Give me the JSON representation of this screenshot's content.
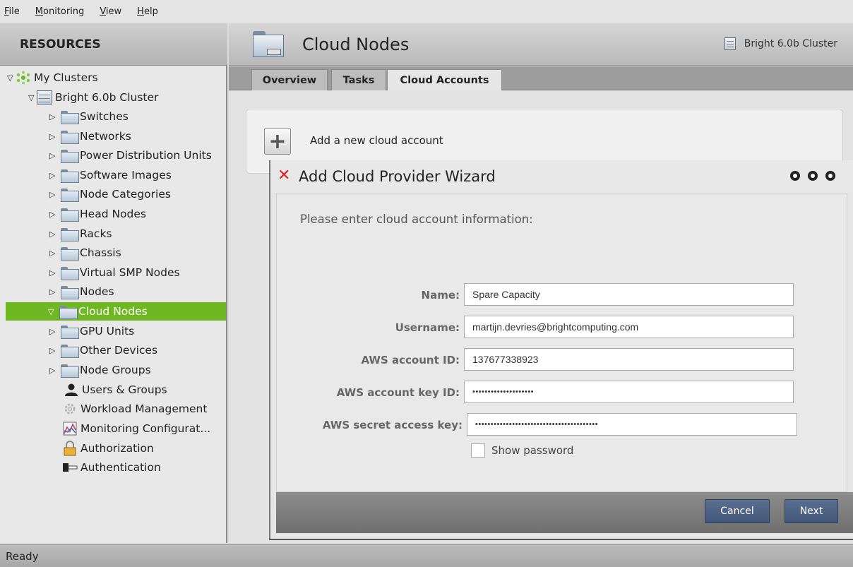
{
  "menubar": {
    "items": [
      "File",
      "Monitoring",
      "View",
      "Help"
    ]
  },
  "sidebar": {
    "title": "RESOURCES",
    "root": "My Clusters",
    "cluster": "Bright 6.0b Cluster",
    "items": [
      {
        "label": "Switches"
      },
      {
        "label": "Networks"
      },
      {
        "label": "Power Distribution Units"
      },
      {
        "label": "Software Images"
      },
      {
        "label": "Node Categories"
      },
      {
        "label": "Head Nodes"
      },
      {
        "label": "Racks"
      },
      {
        "label": "Chassis"
      },
      {
        "label": "Virtual SMP Nodes"
      },
      {
        "label": "Nodes"
      },
      {
        "label": "Cloud Nodes",
        "selected": true
      },
      {
        "label": "GPU Units"
      },
      {
        "label": "Other Devices"
      },
      {
        "label": "Node Groups"
      },
      {
        "label": "Users & Groups"
      },
      {
        "label": "Workload Management"
      },
      {
        "label": "Monitoring Configurat..."
      },
      {
        "label": "Authorization"
      },
      {
        "label": "Authentication"
      }
    ]
  },
  "header": {
    "title": "Cloud Nodes",
    "cluster_name": "Bright 6.0b Cluster"
  },
  "tabs": [
    {
      "label": "Overview",
      "active": false
    },
    {
      "label": "Tasks",
      "active": false
    },
    {
      "label": "Cloud Accounts",
      "active": true
    }
  ],
  "account_panel": {
    "add_label": "Add a new cloud account"
  },
  "wizard": {
    "title": "Add Cloud Provider Wizard",
    "prompt": "Please enter cloud account information:",
    "fields": {
      "name_label": "Name:",
      "name_value": "Spare Capacity",
      "username_label": "Username:",
      "username_value": "martijn.devries@brightcomputing.com",
      "account_id_label": "AWS account ID:",
      "account_id_value": "137677338923",
      "key_id_label": "AWS account key ID:",
      "key_id_value": "••••••••••••••••••••",
      "secret_label": "AWS secret access key:",
      "secret_value": "••••••••••••••••••••••••••••••••••••••••"
    },
    "show_password_label": "Show password",
    "show_password_checked": false,
    "cancel_label": "Cancel",
    "next_label": "Next"
  },
  "status": {
    "text": "Ready"
  },
  "colors": {
    "selection_green": "#6fb823",
    "wizard_close_red": "#e0202a",
    "button_blue": "#4a5f82"
  }
}
